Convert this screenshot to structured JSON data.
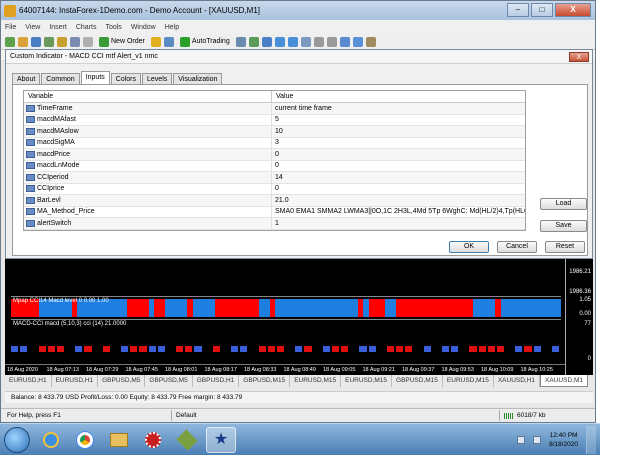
{
  "window": {
    "title": "64007144: InstaForex-1Demo.com - Demo Account - [XAUUSD,M1]",
    "controls": {
      "minimize": "–",
      "maximize": "□",
      "close": "X"
    }
  },
  "menu": [
    "File",
    "View",
    "Insert",
    "Charts",
    "Tools",
    "Window",
    "Help"
  ],
  "toolbar": {
    "new_order": "New Order",
    "autotrading": "AutoTrading"
  },
  "mdi": {
    "minimize": "_",
    "restore": "□",
    "close": "X"
  },
  "dialog": {
    "title": "Custom Indicator - MACD CCI mtf Alert_v1 nmc",
    "close": "X",
    "tabs": [
      "About",
      "Common",
      "Inputs",
      "Colors",
      "Levels",
      "Visualization"
    ],
    "active_tab": "Inputs",
    "columns": {
      "variable": "Variable",
      "value": "Value"
    },
    "params": [
      {
        "name": "TimeFrame",
        "value": "current time frame"
      },
      {
        "name": "macdMAfast",
        "value": "5"
      },
      {
        "name": "macdMAslow",
        "value": "10"
      },
      {
        "name": "macdSigMA",
        "value": "3"
      },
      {
        "name": "macdPrice",
        "value": "0"
      },
      {
        "name": "macdLnMode",
        "value": "0"
      },
      {
        "name": "CCIperiod",
        "value": "14"
      },
      {
        "name": "CCIprice",
        "value": "0"
      },
      {
        "name": "BarLevl",
        "value": "21.0"
      },
      {
        "name": "MA_Method_Price",
        "value": "SMA0 EMA1 SMMA2 LWMA3||0O,1C 2H3L,4Md 5Tp 6WghC: Md(HL/2)4,Tp(HLC/3)5..."
      },
      {
        "name": "alertSwitch",
        "value": "1"
      }
    ],
    "buttons": {
      "load": "Load",
      "save": "Save",
      "ok": "OK",
      "cancel": "Cancel",
      "reset": "Reset"
    }
  },
  "chart": {
    "price_labels": [
      "1986.21",
      "1986.36",
      "1.05",
      "0.00",
      "77",
      "0"
    ],
    "sub1_title": "Mpap CCI14 Macd level 0 0.00 1.00",
    "sub2_title": "MACD-CCI   macd (5,10,3) cci (14) 21.0000",
    "time_labels": [
      "18 Aug 2020",
      "18 Aug 07:13",
      "18 Aug 07:29",
      "18 Aug 07:45",
      "18 Aug 08:01",
      "18 Aug 08:17",
      "18 Aug 08:33",
      "18 Aug 08:49",
      "18 Aug 09:05",
      "18 Aug 09:21",
      "18 Aug 09:37",
      "18 Aug 09:53",
      "18 Aug 10:09",
      "18 Aug 10:25"
    ],
    "colors": {
      "bull": "#1e7fe0",
      "bear": "#ff0000",
      "hist_bull": "#3a5fd8",
      "hist_bear": "#e01010"
    },
    "sub1_segments": [
      {
        "c": "bear",
        "w": 5
      },
      {
        "c": "bull",
        "w": 6
      },
      {
        "c": "bear",
        "w": 1
      },
      {
        "c": "bull",
        "w": 9
      },
      {
        "c": "bear",
        "w": 4
      },
      {
        "c": "bull",
        "w": 1
      },
      {
        "c": "bear",
        "w": 2
      },
      {
        "c": "bull",
        "w": 4
      },
      {
        "c": "bear",
        "w": 1
      },
      {
        "c": "bull",
        "w": 4
      },
      {
        "c": "bear",
        "w": 8
      },
      {
        "c": "bull",
        "w": 2
      },
      {
        "c": "bear",
        "w": 1
      },
      {
        "c": "bull",
        "w": 15
      },
      {
        "c": "bear",
        "w": 1
      },
      {
        "c": "bull",
        "w": 1
      },
      {
        "c": "bear",
        "w": 3
      },
      {
        "c": "bull",
        "w": 2
      },
      {
        "c": "bear",
        "w": 14
      },
      {
        "c": "bull",
        "w": 4
      },
      {
        "c": "bear",
        "w": 1
      },
      {
        "c": "bull",
        "w": 11
      }
    ],
    "sub2_bars": [
      "bull",
      "bull",
      "none",
      "bear",
      "bear",
      "bear",
      "none",
      "bull",
      "bear",
      "none",
      "bear",
      "none",
      "bull",
      "bear",
      "bear",
      "bull",
      "bull",
      "none",
      "bear",
      "bear",
      "bull",
      "none",
      "bear",
      "none",
      "bull",
      "bull",
      "none",
      "bear",
      "bear",
      "bear",
      "none",
      "bull",
      "bear",
      "none",
      "bull",
      "bear",
      "bear",
      "none",
      "bull",
      "bull",
      "none",
      "bear",
      "bear",
      "bear",
      "none",
      "bull",
      "none",
      "bull",
      "bull",
      "none",
      "bear",
      "bear",
      "bear",
      "bear",
      "none",
      "bull",
      "bear",
      "bull",
      "none",
      "bull"
    ],
    "tabs": [
      "EURUSD,H1",
      "EURUSD,H1",
      "GBPUSD,M5",
      "GBPUSD,M5",
      "GBPUSD,H1",
      "GBPUSD,M15",
      "EURUSD,M15",
      "EURUSD,M15",
      "GBPUSD,M15",
      "EURUSD,M15",
      "XAUUSD,H1",
      "XAUUSD,M1"
    ],
    "active_tab": "XAUUSD,M1"
  },
  "balance": "Balance: 8 433.79 USD  Profit/Loss: 0.00  Equity: 8 433.79  Free margin: 8 433.79",
  "status": {
    "help": "For Help, press F1",
    "profile": "Default",
    "traffic": "6018/7 kb"
  },
  "taskbar": {
    "apps": [
      "ie-icon",
      "chrome-icon",
      "explorer-icon",
      "gear-app-icon",
      "trading-app-icon",
      "metatrader-icon"
    ],
    "time": "12:40 PM",
    "date": "8/18/2020"
  }
}
